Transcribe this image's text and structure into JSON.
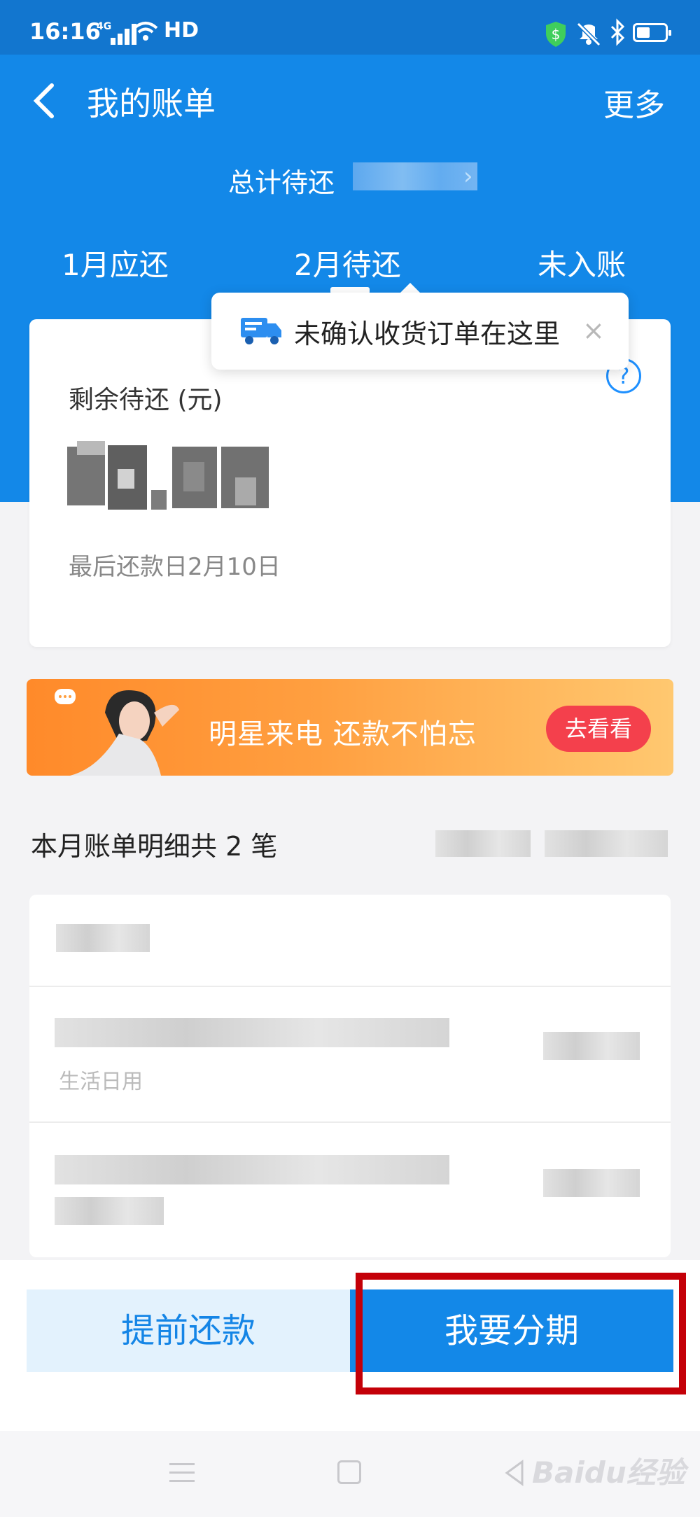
{
  "status_bar": {
    "time": "16:16",
    "network": "4G",
    "hd": "HD"
  },
  "header": {
    "title": "我的账单",
    "more": "更多",
    "total_due_label": "总计待还"
  },
  "tabs": [
    {
      "label": "1月应还",
      "active": false
    },
    {
      "label": "2月待还",
      "active": true
    },
    {
      "label": "未入账",
      "active": false
    }
  ],
  "tooltip": {
    "text": "未确认收货订单在这里",
    "close": "×"
  },
  "summary": {
    "remaining_label": "剩余待还 (元)",
    "help": "?",
    "due_date": "最后还款日2月10日"
  },
  "banner": {
    "text": "明星来电 还款不怕忘",
    "button": "去看看"
  },
  "details": {
    "title": "本月账单明细共 2 笔",
    "rows": [
      {
        "category": "生活日用"
      }
    ]
  },
  "actions": {
    "prepay": "提前还款",
    "installment": "我要分期"
  },
  "watermark": "Baidu经验",
  "colors": {
    "brand_blue": "#1388e8",
    "banner_orange": "#ff9f40",
    "highlight_red": "#c40008"
  }
}
